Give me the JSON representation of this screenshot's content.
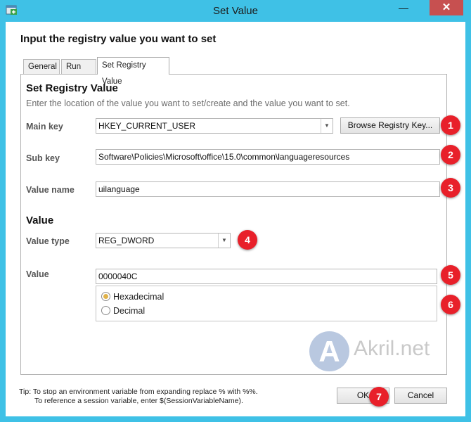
{
  "window": {
    "title": "Set Value",
    "close": "✕",
    "minimize": "—"
  },
  "heading": "Input the registry value you want to set",
  "tabs": [
    {
      "label": "General"
    },
    {
      "label": "Run As"
    },
    {
      "label": "Set Registry Value"
    }
  ],
  "registry": {
    "section_title": "Set Registry Value",
    "description": "Enter the location of the value you want to set/create and the value you want to set.",
    "main_key_label": "Main key",
    "main_key_value": "HKEY_CURRENT_USER",
    "browse_button": "Browse Registry Key...",
    "sub_key_label": "Sub key",
    "sub_key_value": "Software\\Policies\\Microsoft\\office\\15.0\\common\\languageresources",
    "value_name_label": "Value name",
    "value_name_value": "uilanguage"
  },
  "value_section": {
    "title": "Value",
    "type_label": "Value type",
    "type_value": "REG_DWORD",
    "value_label": "Value",
    "value_value": "0000040C",
    "radio_hex": "Hexadecimal",
    "radio_dec": "Decimal",
    "selected": "Hexadecimal"
  },
  "markers": [
    "1",
    "2",
    "3",
    "4",
    "5",
    "6",
    "7"
  ],
  "tip": {
    "line1": "Tip: To stop an environment variable from expanding replace % with %%.",
    "line2": "To reference a session variable, enter $(SessionVariableName)."
  },
  "buttons": {
    "ok": "OK",
    "cancel": "Cancel"
  },
  "watermark": {
    "glyph": "A",
    "text": "Akril.net"
  },
  "colors": {
    "frame": "#3fc1e6",
    "close": "#c75050",
    "marker": "#e8202a"
  }
}
